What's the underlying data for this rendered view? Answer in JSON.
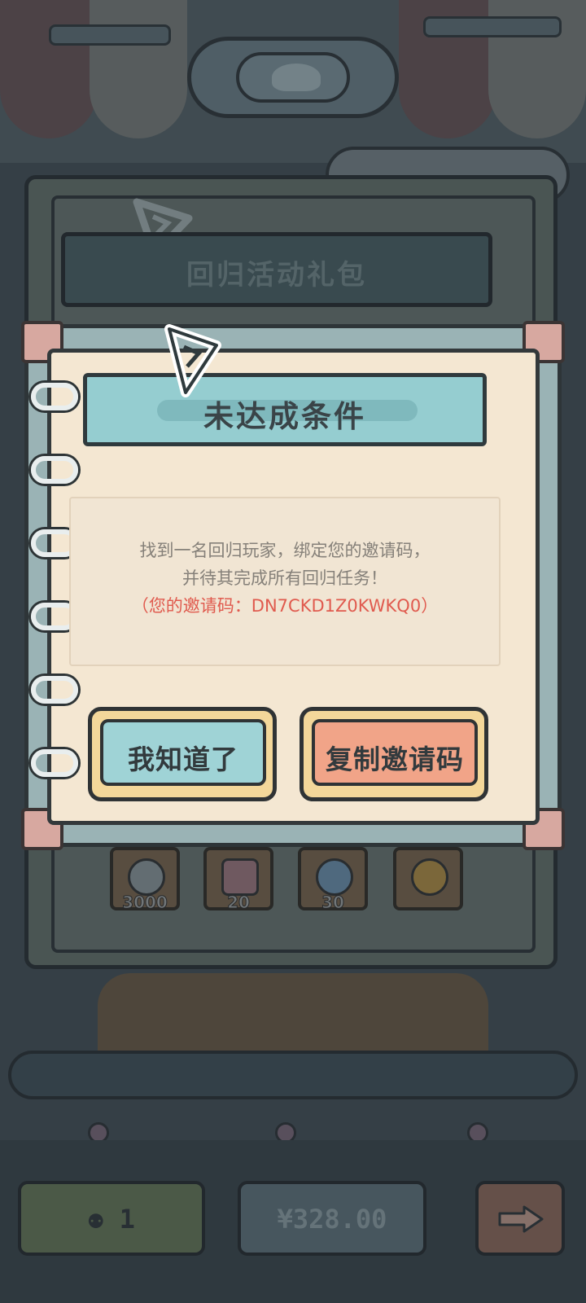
{
  "background": {
    "panel_title": "回归活动礼包",
    "rewards": [
      {
        "icon": "ghost-icon",
        "count": "3000"
      },
      {
        "icon": "ticket-icon",
        "count": "20"
      },
      {
        "icon": "gem-icon",
        "count": "30"
      },
      {
        "icon": "ring-icon",
        "count": ""
      }
    ]
  },
  "dialog": {
    "title": "未达成条件",
    "message_line1": "找到一名回归玩家，绑定您的邀请码，",
    "message_line2": "并待其完成所有回归任务！",
    "invite_code_line": "（您的邀请码：DN7CKD1Z0KWKQ0）",
    "confirm_label": "我知道了",
    "copy_label": "复制邀请码"
  },
  "bottom_bar": {
    "ticket_count": "1",
    "price": "¥328.00",
    "next_icon": "arrow-right-icon"
  },
  "colors": {
    "accent_teal": "#95cdd0",
    "accent_orange": "#f1a488",
    "invite_red": "#e05a4e",
    "paper": "#f4e7d2"
  }
}
